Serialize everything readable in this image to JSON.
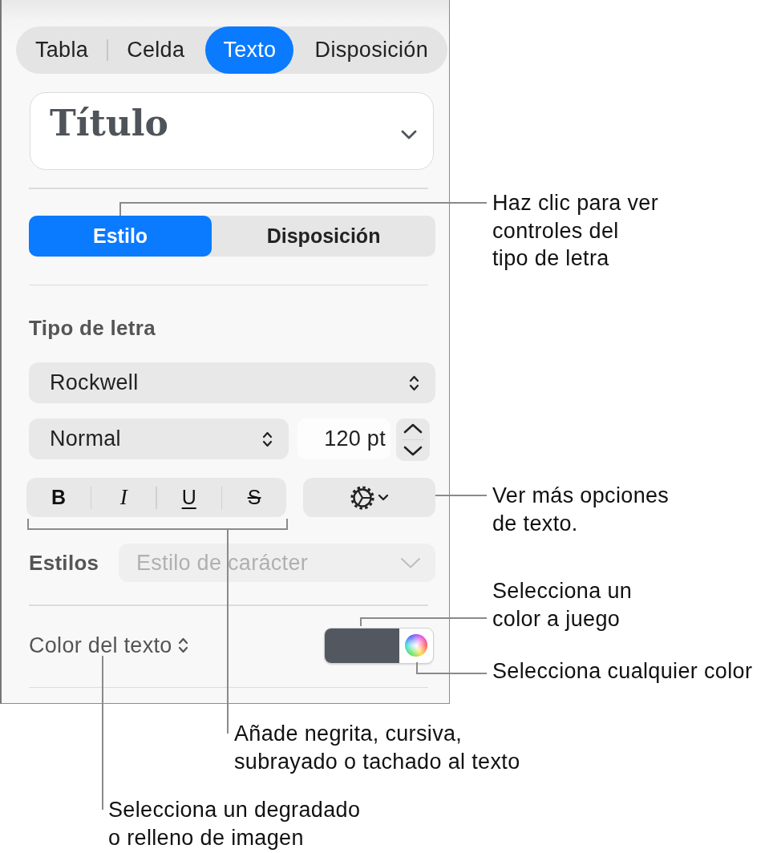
{
  "tabs": [
    {
      "label": "Tabla",
      "selected": false
    },
    {
      "label": "Celda",
      "selected": false
    },
    {
      "label": "Texto",
      "selected": true
    },
    {
      "label": "Disposición",
      "selected": false
    }
  ],
  "paragraph_style": {
    "value": "Título"
  },
  "subtabs": [
    {
      "label": "Estilo",
      "selected": true
    },
    {
      "label": "Disposición",
      "selected": false
    }
  ],
  "font": {
    "heading": "Tipo de letra",
    "family": "Rockwell",
    "typeface": "Normal",
    "size": "120 pt"
  },
  "format_buttons": [
    {
      "label": "B",
      "kind": "bold"
    },
    {
      "label": "I",
      "kind": "italic"
    },
    {
      "label": "U",
      "kind": "underline"
    },
    {
      "label": "S",
      "kind": "strikethrough"
    }
  ],
  "character_styles": {
    "label": "Estilos",
    "value": "Estilo de carácter",
    "disabled": true
  },
  "text_color": {
    "label": "Color del texto",
    "color": "#53575f"
  },
  "callouts": [
    {
      "lines": [
        "Haz clic para ver",
        "controles del",
        "tipo de letra"
      ]
    },
    {
      "lines": [
        "Ver más opciones",
        "de texto."
      ]
    },
    {
      "lines": [
        "Selecciona un",
        "color a juego"
      ]
    },
    {
      "lines": [
        "Selecciona cualquier color"
      ]
    },
    {
      "lines": [
        "Añade negrita, cursiva,",
        "subrayado o tachado al texto"
      ]
    },
    {
      "lines": [
        "Selecciona un degradado",
        "o relleno de imagen"
      ]
    }
  ]
}
